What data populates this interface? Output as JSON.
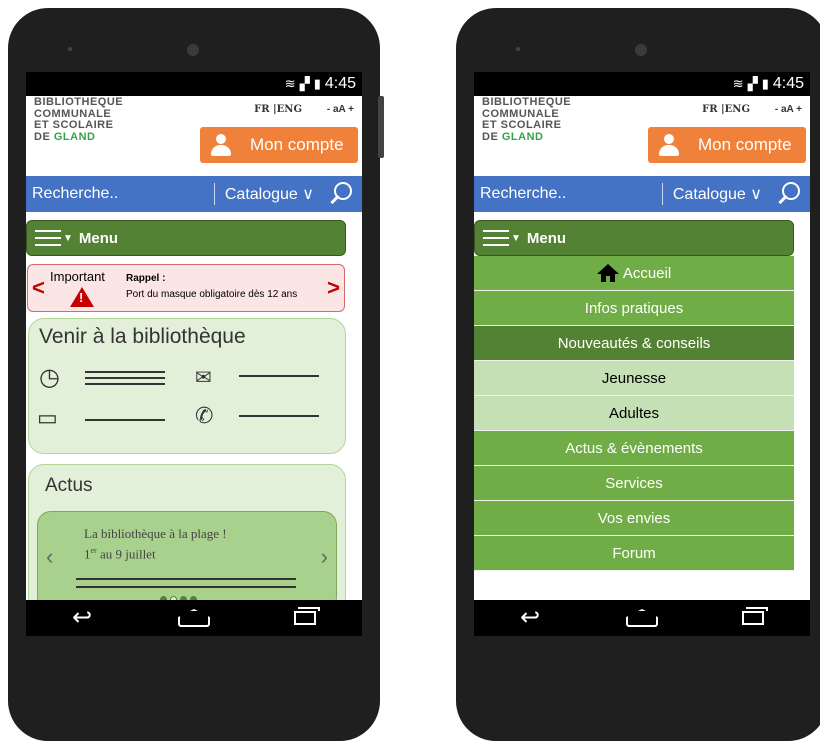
{
  "statusbar": {
    "time": "4:45",
    "icons": [
      "wifi-icon",
      "signal-icon",
      "battery-icon"
    ]
  },
  "header": {
    "logo_line1": "BIBLIOTHEQUE",
    "logo_line2": "COMMUNALE",
    "logo_line3": "ET SCOLAIRE",
    "logo_line4_prefix": "DE",
    "logo_line4_highlight": "GLAND",
    "lang": "FR |ENG",
    "text_size": "- aA +",
    "account_label": "Mon compte"
  },
  "search": {
    "placeholder": "Recherche..",
    "catalogue_label": "Catalogue"
  },
  "menu": {
    "label": "Menu",
    "items": [
      {
        "label": "Accueil",
        "state": "normal"
      },
      {
        "label": "Infos pratiques",
        "state": "normal"
      },
      {
        "label": "Nouveautés & conseils",
        "state": "expanded"
      },
      {
        "label": "Jeunesse",
        "state": "sub"
      },
      {
        "label": "Adultes",
        "state": "sub"
      },
      {
        "label": "Actus & évènements",
        "state": "normal"
      },
      {
        "label": "Services",
        "state": "normal"
      },
      {
        "label": "Vos envies",
        "state": "normal"
      },
      {
        "label": "Forum",
        "state": "normal"
      }
    ]
  },
  "alert": {
    "label": "Important",
    "title": "Rappel :",
    "message": "Port du masque obligatoire dès 12 ans"
  },
  "visit": {
    "title": "Venir à la bibliothèque"
  },
  "news": {
    "title": "Actus",
    "slide_title": "La bibliothèque à la plage !",
    "slide_date_num": "1",
    "slide_date_sup": "er",
    "slide_date_rest": " au 9 juillet",
    "slide_index": 2,
    "slide_count": 4
  },
  "colors": {
    "account": "#f0813a",
    "search": "#4472c4",
    "menu_dark": "#548235",
    "menu_item": "#70ad47",
    "submenu": "#c5e0b4",
    "alert": "#c40000"
  }
}
